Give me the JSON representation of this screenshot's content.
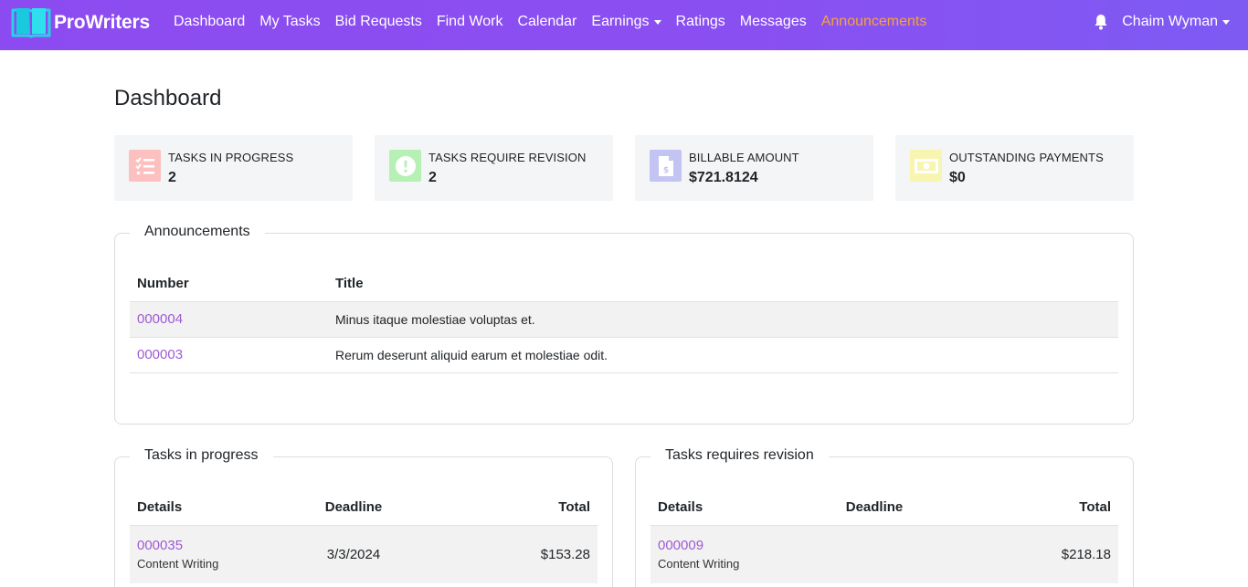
{
  "brand": {
    "name": "ProWriters"
  },
  "nav": {
    "items": [
      {
        "label": "Dashboard"
      },
      {
        "label": "My Tasks"
      },
      {
        "label": "Bid Requests"
      },
      {
        "label": "Find Work"
      },
      {
        "label": "Calendar"
      },
      {
        "label": "Earnings"
      },
      {
        "label": "Ratings"
      },
      {
        "label": "Messages"
      },
      {
        "label": "Announcements"
      }
    ],
    "active": "Announcements",
    "user": "Chaim Wyman"
  },
  "page": {
    "title": "Dashboard"
  },
  "stats": [
    {
      "label": "TASKS IN PROGRESS",
      "value": "2",
      "icon": "task-list-icon",
      "color": "#fdc0c0"
    },
    {
      "label": "TASKS REQUIRE REVISION",
      "value": "2",
      "icon": "alert-circle-icon",
      "color": "#b7f0b4"
    },
    {
      "label": "BILLABLE AMOUNT",
      "value": "$721.8124",
      "icon": "invoice-dollar-icon",
      "color": "#c4c4f2"
    },
    {
      "label": "OUTSTANDING PAYMENTS",
      "value": "$0",
      "icon": "money-bill-icon",
      "color": "#f7f5b0"
    }
  ],
  "announcements": {
    "legend": "Announcements",
    "columns": [
      "Number",
      "Title"
    ],
    "rows": [
      {
        "number": "000004",
        "title": "Minus itaque molestiae voluptas et."
      },
      {
        "number": "000003",
        "title": "Rerum deserunt aliquid earum et molestiae odit."
      }
    ]
  },
  "tasks_in_progress": {
    "legend": "Tasks in progress",
    "columns": [
      "Details",
      "Deadline",
      "Total"
    ],
    "rows": [
      {
        "id": "000035",
        "type": "Content Writing",
        "deadline": "3/3/2024",
        "total": "$153.28"
      }
    ]
  },
  "tasks_revision": {
    "legend": "Tasks requires revision",
    "columns": [
      "Details",
      "Deadline",
      "Total"
    ],
    "rows": [
      {
        "id": "000009",
        "type": "Content Writing",
        "deadline": "",
        "total": "$218.18"
      }
    ]
  }
}
